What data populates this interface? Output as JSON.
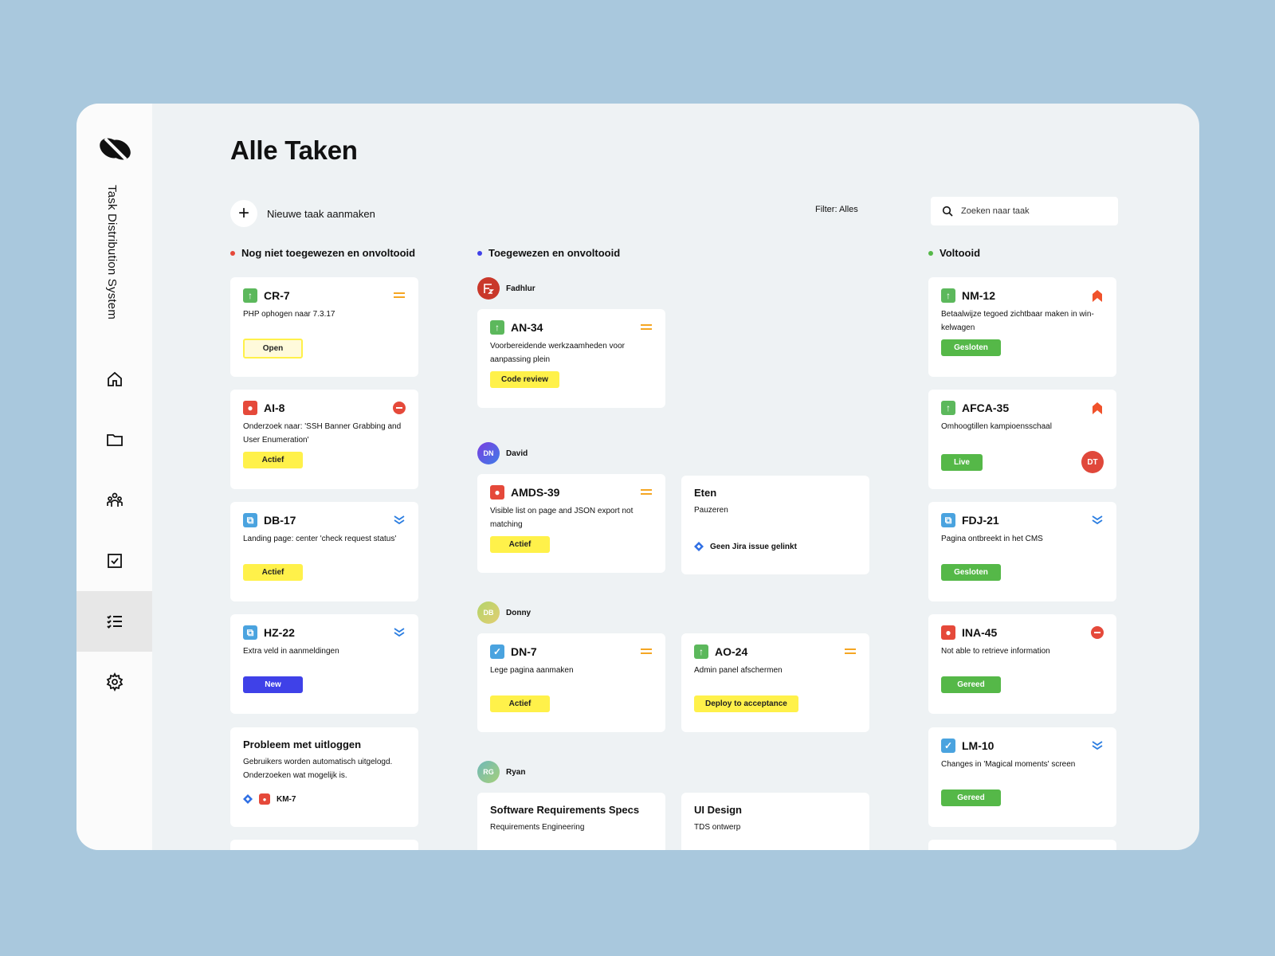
{
  "app": {
    "brand": "Task Distribution System"
  },
  "header": {
    "title": "Alle Taken",
    "new_task": "Nieuwe taak aanmaken",
    "filter": "Filter: Alles",
    "search_placeholder": "Zoeken naar taak"
  },
  "colors": {
    "unassigned": "#e5493a",
    "assigned": "#3f41e8",
    "done": "#55b848",
    "yellow": "#fff14a"
  },
  "columns": {
    "unassigned": {
      "label": "Nog niet toegewezen en onvoltooid",
      "cards": [
        {
          "key": "CR-7",
          "desc": "PHP ophogen naar 7.3.17",
          "badge": "Open"
        },
        {
          "key": "AI-8",
          "desc": "Onderzoek naar: 'SSH Banner Grabbing and User Enumeration'",
          "badge": "Actief"
        },
        {
          "key": "DB-17",
          "desc": "Landing page: center 'check request status'",
          "badge": "Actief"
        },
        {
          "key": "HZ-22",
          "desc": "Extra veld in aanmeldingen",
          "badge": "New"
        },
        {
          "title": "Probleem met uitloggen",
          "desc": "Gebruikers worden automatisch uitgelogd. Onderzoeken wat mogelijk is.",
          "link": "KM-7"
        }
      ]
    },
    "assigned": {
      "label": "Toegewezen en onvoltooid",
      "people": [
        {
          "name": "Fadhlur",
          "initials": "",
          "cards": [
            {
              "key": "AN-34",
              "desc": "Voorbereidende werkzaamheden voor aanpassing plein",
              "badge": "Code review"
            }
          ]
        },
        {
          "name": "David",
          "initials": "DN",
          "cards": [
            {
              "key": "AMDS-39",
              "desc": "Visible list on page and JSON export not matching",
              "badge": "Actief"
            },
            {
              "title": "Eten",
              "desc": "Pauzeren",
              "link": "Geen Jira issue gelinkt"
            }
          ]
        },
        {
          "name": "Donny",
          "initials": "DB",
          "cards": [
            {
              "key": "DN-7",
              "desc": "Lege pagina aanmaken",
              "badge": "Actief"
            },
            {
              "key": "AO-24",
              "desc": "Admin panel afschermen",
              "badge": "Deploy to acceptance"
            }
          ]
        },
        {
          "name": "Ryan",
          "initials": "RG",
          "cards": [
            {
              "title": "Software Requirements Specs",
              "desc": "Requirements Engineering"
            },
            {
              "title": "UI Design",
              "desc": "TDS ontwerp"
            }
          ]
        }
      ]
    },
    "done": {
      "label": "Voltooid",
      "cards": [
        {
          "key": "NM-12",
          "desc": "Betaalwijze tegoed zichtbaar maken in win-kelwagen",
          "badge": "Gesloten"
        },
        {
          "key": "AFCA-35",
          "desc": "Omhoogtillen kampioensschaal",
          "badge": "Live",
          "assignee": "DT"
        },
        {
          "key": "FDJ-21",
          "desc": "Pagina ontbreekt in het CMS",
          "badge": "Gesloten"
        },
        {
          "key": "INA-45",
          "desc": "Not able to retrieve information",
          "badge": "Gereed"
        },
        {
          "key": "LM-10",
          "desc": "Changes in 'Magical moments' screen",
          "badge": "Gereed"
        }
      ]
    }
  }
}
